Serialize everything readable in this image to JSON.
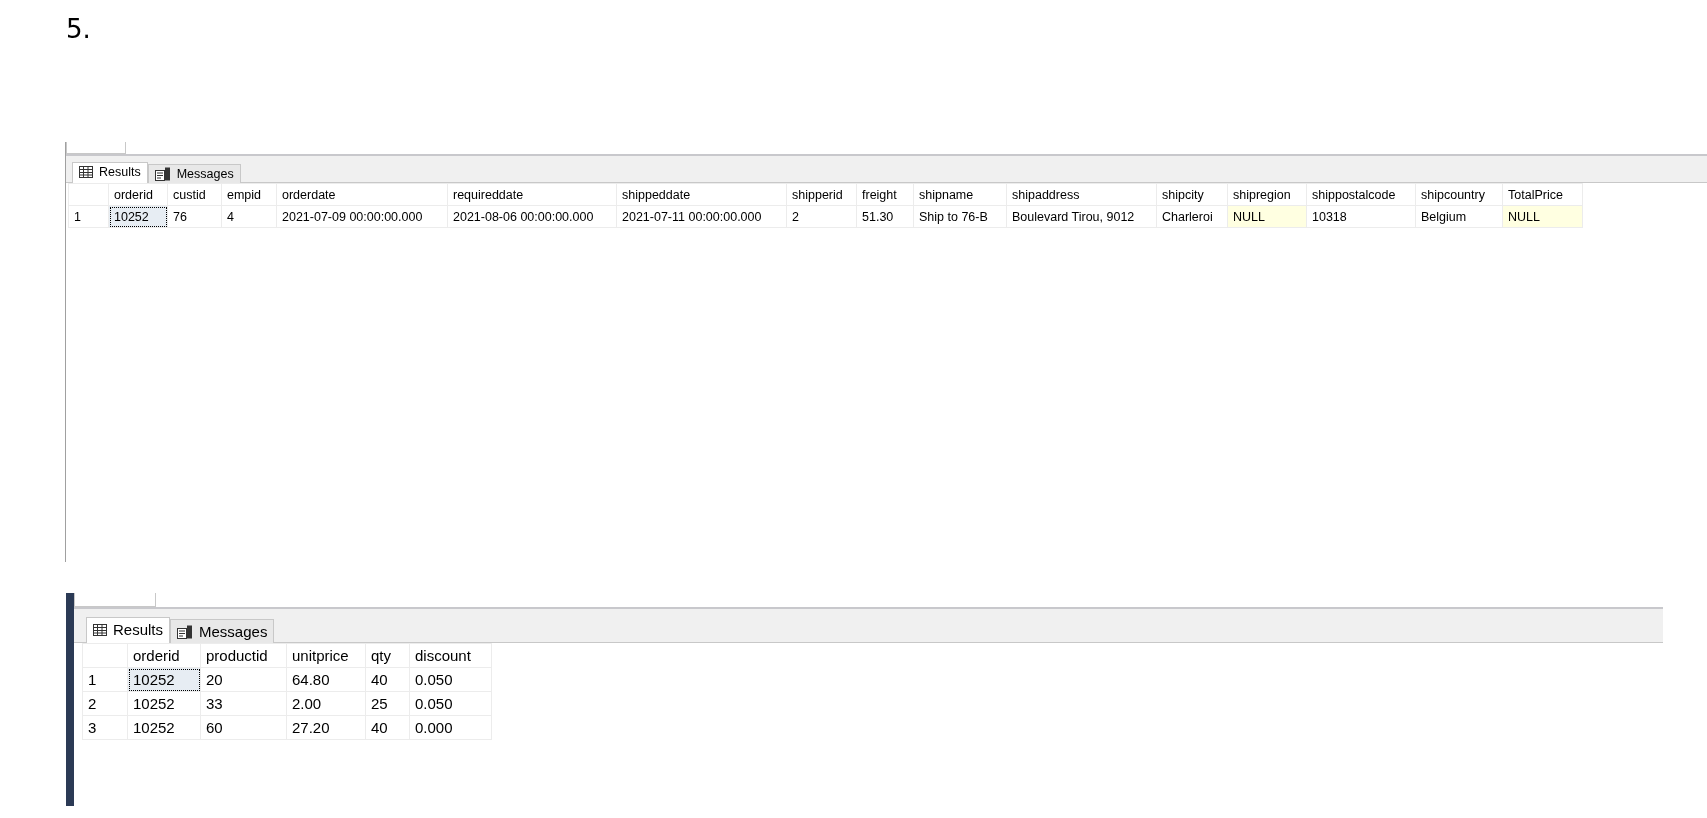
{
  "heading": "5.",
  "panes": [
    {
      "tabs": [
        {
          "label": "Results",
          "selected": true
        },
        {
          "label": "Messages",
          "selected": false
        }
      ],
      "columns": [
        "orderid",
        "custid",
        "empid",
        "orderdate",
        "requireddate",
        "shippeddate",
        "shipperid",
        "freight",
        "shipname",
        "shipaddress",
        "shipcity",
        "shipregion",
        "shippostalcode",
        "shipcountry",
        "TotalPrice"
      ],
      "rows": [
        {
          "number": "1",
          "cells": [
            {
              "text": "10252",
              "focused": true
            },
            "76",
            "4",
            "2021-07-09 00:00:00.000",
            "2021-08-06 00:00:00.000",
            "2021-07-11 00:00:00.000",
            "2",
            "51.30",
            "Ship to 76-B",
            "Boulevard Tirou, 9012",
            "Charleroi",
            {
              "text": "NULL",
              "kind": "null"
            },
            "10318",
            "Belgium",
            {
              "text": "NULL",
              "kind": "null"
            }
          ]
        }
      ]
    },
    {
      "tabs": [
        {
          "label": "Results",
          "selected": true
        },
        {
          "label": "Messages",
          "selected": false
        }
      ],
      "columns": [
        "orderid",
        "productid",
        "unitprice",
        "qty",
        "discount"
      ],
      "rows": [
        {
          "number": "1",
          "cells": [
            {
              "text": "10252",
              "focused": true
            },
            "20",
            "64.80",
            "40",
            "0.050"
          ]
        },
        {
          "number": "2",
          "cells": [
            "10252",
            "33",
            "2.00",
            "25",
            "0.050"
          ]
        },
        {
          "number": "3",
          "cells": [
            "10252",
            "60",
            "27.20",
            "40",
            "0.000"
          ]
        }
      ]
    }
  ]
}
